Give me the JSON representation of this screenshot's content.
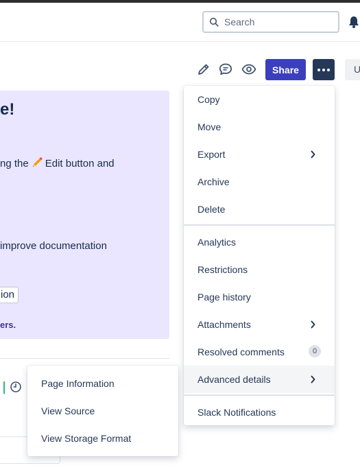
{
  "header": {
    "search_placeholder": "Search"
  },
  "toolbar": {
    "share_label": "Share",
    "user_initial": "U"
  },
  "panel": {
    "title": "e!",
    "line1_before": "ng the",
    "line1_after": "Edit button and",
    "line2": "improve documentation",
    "chip_label": "ion",
    "link_label": "ers."
  },
  "menu": {
    "items": [
      {
        "label": "Copy"
      },
      {
        "label": "Move"
      },
      {
        "label": "Export"
      },
      {
        "label": "Archive"
      },
      {
        "label": "Delete"
      },
      {
        "label": "Analytics"
      },
      {
        "label": "Restrictions"
      },
      {
        "label": "Page history"
      },
      {
        "label": "Attachments"
      },
      {
        "label": "Resolved comments",
        "badge": "0"
      },
      {
        "label": "Advanced details"
      },
      {
        "label": "Slack Notifications"
      }
    ]
  },
  "submenu": {
    "items": [
      {
        "label": "Page Information"
      },
      {
        "label": "View Source"
      },
      {
        "label": "View Storage Format"
      }
    ]
  },
  "colors": {
    "share_bg": "#3b3fbd",
    "more_bg": "#253858",
    "panel_bg": "#eae6ff",
    "link": "#403294"
  }
}
